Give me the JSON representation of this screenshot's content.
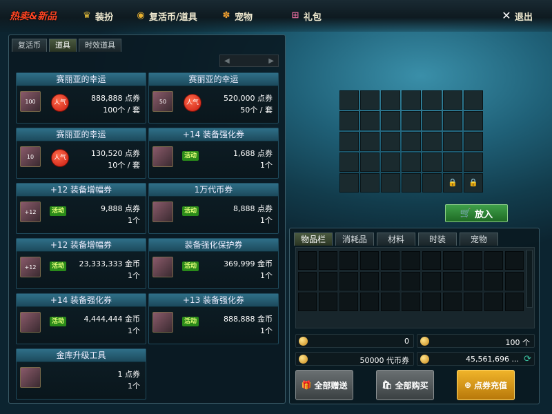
{
  "topbar": {
    "hot": "热卖&新品",
    "dress": "装扮",
    "coin": "复活币/道具",
    "pet": "宠物",
    "gift": "礼包",
    "exit": "退出"
  },
  "left": {
    "tabs": [
      "复活币",
      "道具",
      "时效道具"
    ],
    "active_tab": "道具",
    "pager": {
      "prev": "◀",
      "next": "▶"
    },
    "cards": [
      {
        "title": "赛丽亚的幸运",
        "icon_text": "100",
        "tag": "人气",
        "tag_type": "hot",
        "price": "888,888 点券",
        "qty": "100个 / 套"
      },
      {
        "title": "赛丽亚的幸运",
        "icon_text": "50",
        "tag": "人气",
        "tag_type": "hot",
        "price": "520,000 点券",
        "qty": "50个 / 套"
      },
      {
        "title": "赛丽亚的幸运",
        "icon_text": "10",
        "tag": "人气",
        "tag_type": "hot",
        "price": "130,520 点券",
        "qty": "10个 / 套"
      },
      {
        "title": "+14 装备强化券",
        "icon_text": "",
        "tag": "活动",
        "tag_type": "act",
        "price": "1,688 点券",
        "qty": "1个"
      },
      {
        "title": "+12 装备增幅券",
        "icon_text": "+12",
        "tag": "活动",
        "tag_type": "act",
        "price": "9,888 点券",
        "qty": "1个"
      },
      {
        "title": "1万代币券",
        "icon_text": "",
        "tag": "活动",
        "tag_type": "act",
        "price": "8,888 点券",
        "qty": "1个"
      },
      {
        "title": "+12 装备增幅券",
        "icon_text": "+12",
        "tag": "活动",
        "tag_type": "act",
        "price": "23,333,333 金币",
        "qty": "1个"
      },
      {
        "title": "装备强化保护券",
        "icon_text": "",
        "tag": "活动",
        "tag_type": "act",
        "price": "369,999 金币",
        "qty": "1个"
      },
      {
        "title": "+14 装备强化券",
        "icon_text": "",
        "tag": "活动",
        "tag_type": "act",
        "price": "4,444,444 金币",
        "qty": "1个"
      },
      {
        "title": "+13 装备强化券",
        "icon_text": "",
        "tag": "活动",
        "tag_type": "act",
        "price": "888,888 金币",
        "qty": "1个"
      },
      {
        "title": "金库升级工具",
        "icon_text": "",
        "tag": "",
        "tag_type": "none",
        "price": "1 点券",
        "qty": "1个"
      }
    ]
  },
  "slots": {
    "locked_icon": "lock-icon",
    "put_in": "放入"
  },
  "inventory": {
    "tabs": [
      "物品栏",
      "消耗品",
      "材料",
      "时装",
      "宠物"
    ],
    "active_tab": "物品栏",
    "stats": {
      "a": "0",
      "b": "100 个",
      "c": "50000 代币券",
      "d": "45,561,696 ..."
    },
    "buttons": {
      "gift_all": "全部赠送",
      "buy_all": "全部购买",
      "recharge": "点券充值"
    }
  },
  "colors": {
    "accent_green": "#2a8a1a",
    "hot_red": "#c81a10",
    "recharge_gold": "#f0b42a"
  }
}
